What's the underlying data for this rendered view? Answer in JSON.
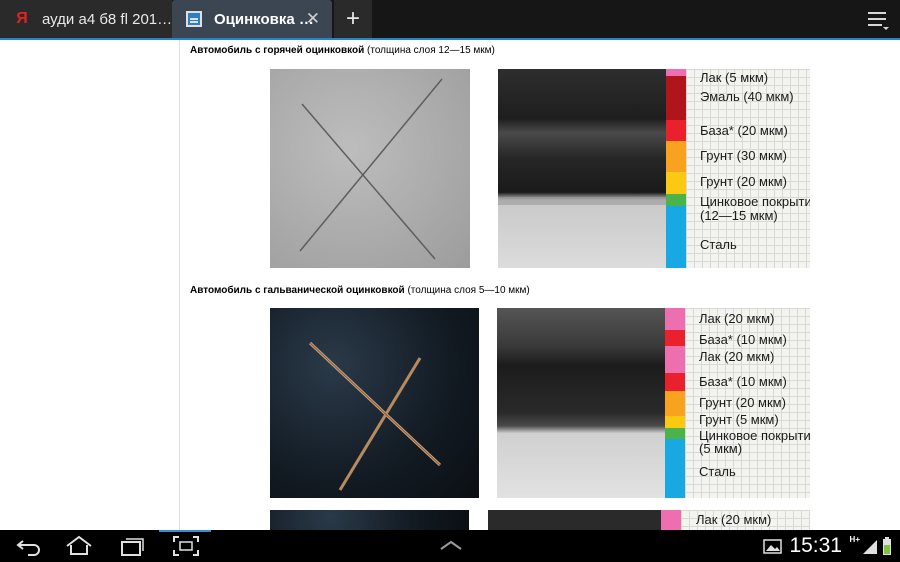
{
  "tabs": [
    {
      "label": "ауди а4 б8 fl 201…",
      "icon": "yandex-icon",
      "active": false
    },
    {
      "label": "Оцинковка …",
      "icon": "page-icon",
      "active": true
    }
  ],
  "tabbar": {
    "close_glyph": "✕",
    "new_tab_glyph": "+"
  },
  "sections": [
    {
      "title_bold": "Автомобиль с горячей оцинковкой",
      "title_rest": " (толщина слоя 12—15 мкм)",
      "layers": [
        {
          "label": "Лак (5 мкм)",
          "color": "#ee6fb0"
        },
        {
          "label": "Эмаль (40 мкм)",
          "color": "#b0151b"
        },
        {
          "label": "База* (20 мкм)",
          "color": "#e8212c"
        },
        {
          "label": "Грунт (30 мкм)",
          "color": "#f7a31f"
        },
        {
          "label": "Грунт (20 мкм)",
          "color": "#fbc812"
        },
        {
          "label": "Цинковое покрытие",
          "color": "#4cb34a"
        },
        {
          "label": "(12—15 мкм)",
          "color": ""
        },
        {
          "label": "Сталь",
          "color": "#18a9e3"
        }
      ]
    },
    {
      "title_bold": "Автомобиль с гальванической оцинковкой",
      "title_rest": " (толщина слоя 5—10 мкм)",
      "layers": [
        {
          "label": "Лак (20 мкм)",
          "color": "#ee6fb0"
        },
        {
          "label": "База* (10 мкм)",
          "color": "#e8212c"
        },
        {
          "label": "Лак (20 мкм)",
          "color": "#ee6fb0"
        },
        {
          "label": "База* (10 мкм)",
          "color": "#e8212c"
        },
        {
          "label": "Грунт (20 мкм)",
          "color": "#f7a31f"
        },
        {
          "label": "Грунт (5 мкм)",
          "color": "#fbc812"
        },
        {
          "label": "Цинковое покрытие",
          "color": "#4cb34a"
        },
        {
          "label": "(5 мкм)",
          "color": ""
        },
        {
          "label": "Сталь",
          "color": "#18a9e3"
        }
      ]
    },
    {
      "layers": [
        {
          "label": "Лак (20 мкм)",
          "color": "#ee6fb0"
        }
      ]
    }
  ],
  "status": {
    "time": "15:31",
    "network": "H+"
  },
  "colors": {
    "tab_accent": "#1f86c8",
    "tabbar_bg": "#161616",
    "active_tab_bg": "#3b4652"
  }
}
